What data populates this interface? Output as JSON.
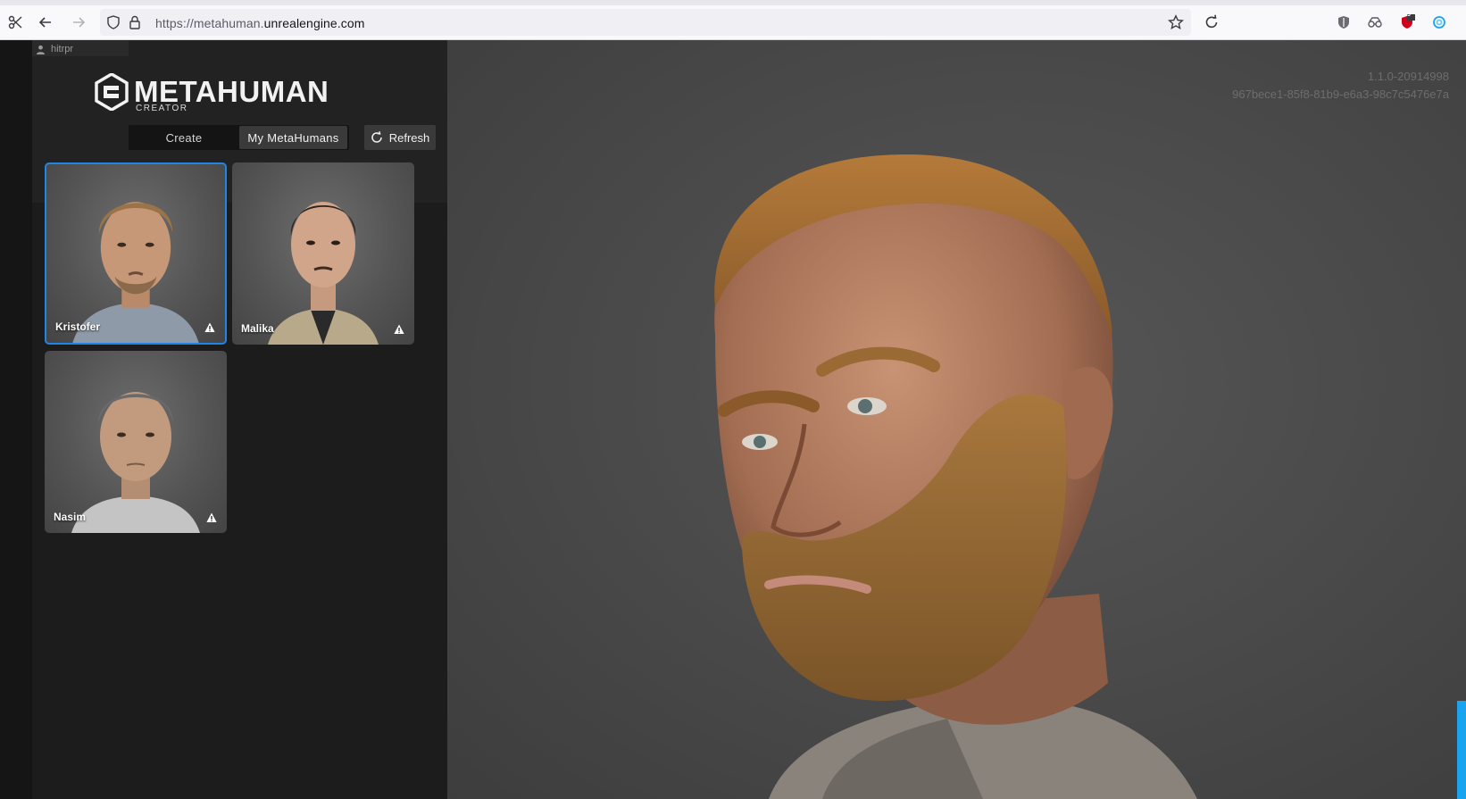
{
  "browser": {
    "url_prefix": "https://metahuman.",
    "url_domain": "unrealengine.com",
    "extension_badge": "3"
  },
  "user": {
    "name": "hitrpr"
  },
  "app": {
    "logo_word": "METAHUMAN",
    "logo_sub": "CREATOR",
    "tabs": [
      {
        "label": "Create",
        "active": false
      },
      {
        "label": "My MetaHumans",
        "active": true
      }
    ],
    "refresh_label": "Refresh",
    "accent_color": "#1f86e8"
  },
  "metahumans": [
    {
      "name": "Kristofer",
      "selected": true,
      "warning": true
    },
    {
      "name": "Malika",
      "selected": false,
      "warning": true
    },
    {
      "name": "Nasim",
      "selected": false,
      "warning": true
    }
  ],
  "viewport": {
    "version": "1.1.0-20914998",
    "session_id": "967bece1-85f8-81b9-e6a3-98c7c5476e7a"
  }
}
